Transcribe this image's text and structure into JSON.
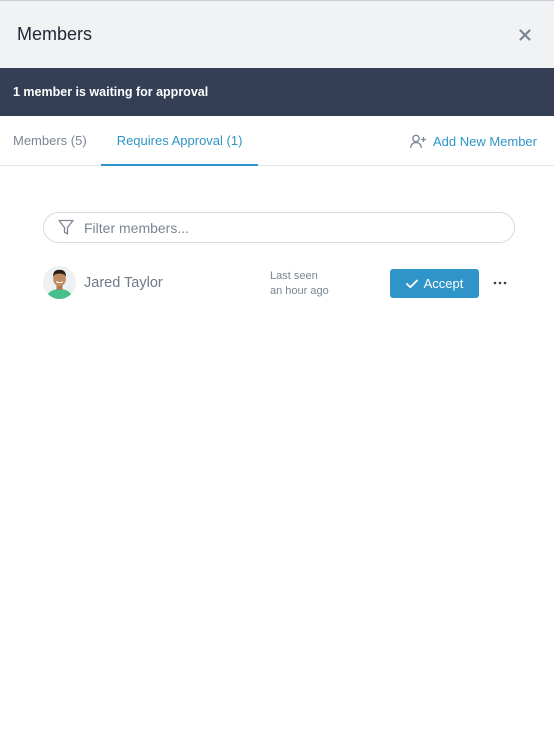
{
  "header": {
    "title": "Members",
    "close_icon": "close-icon"
  },
  "banner": {
    "text": "1 member is waiting for approval"
  },
  "tabs": [
    {
      "label": "Members (5)",
      "active": false
    },
    {
      "label": "Requires Approval (1)",
      "active": true
    }
  ],
  "add_member": {
    "label": "Add New Member",
    "icon": "add-user-icon"
  },
  "filter": {
    "placeholder": "Filter members...",
    "value": "",
    "icon": "filter-icon"
  },
  "members": [
    {
      "name": "Jared Taylor",
      "last_seen_line1": "Last seen",
      "last_seen_line2": "an hour ago",
      "accept_label": "Accept",
      "more_icon": "more-horizontal-icon"
    }
  ],
  "colors": {
    "accent": "#2f95c8",
    "banner_bg": "#343f55",
    "header_bg": "#f0f2f4"
  }
}
